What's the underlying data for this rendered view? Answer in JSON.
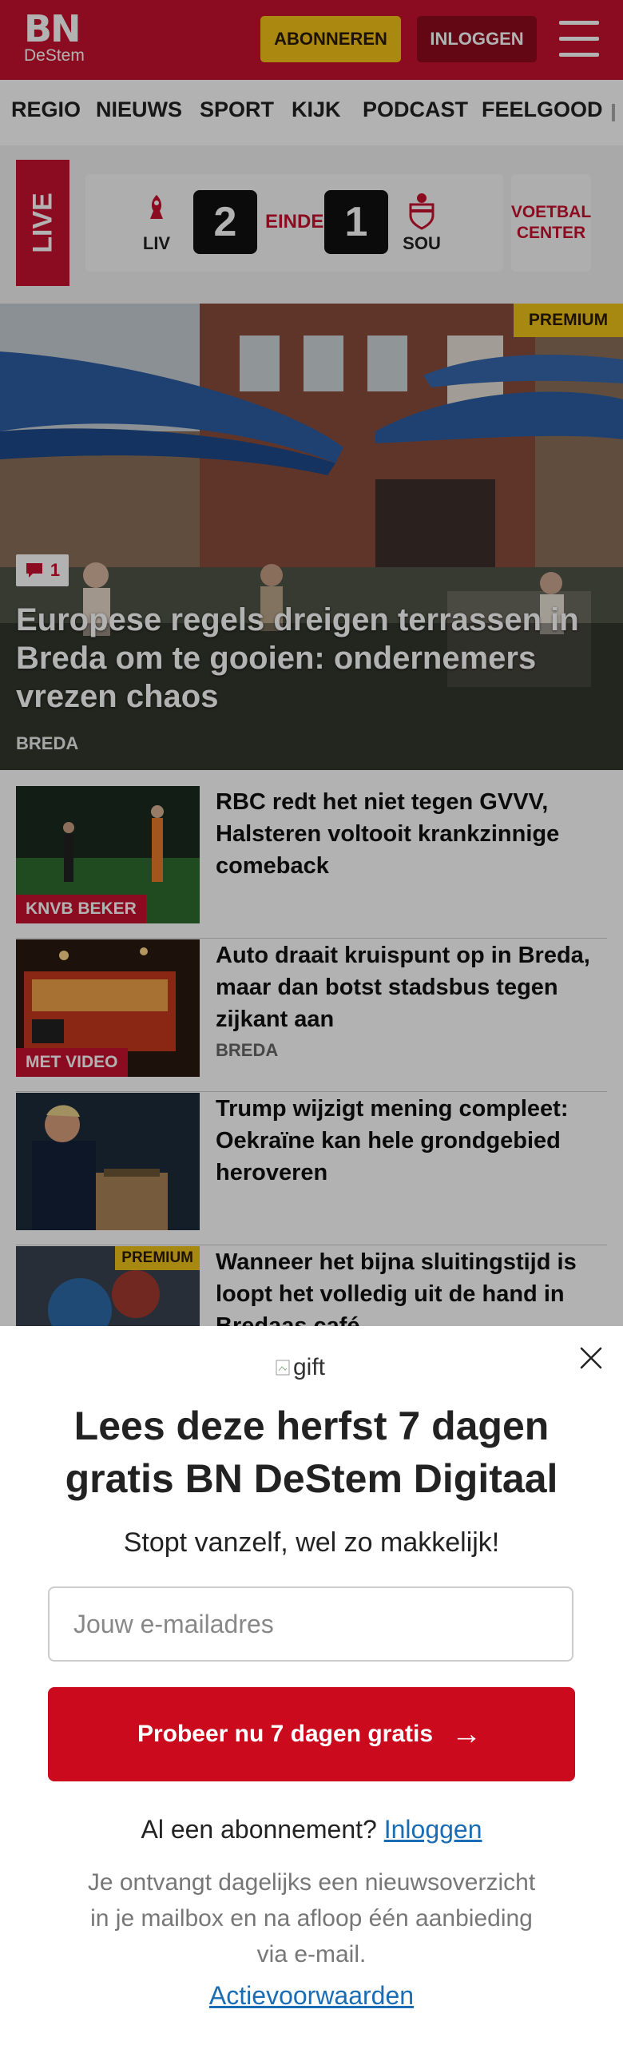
{
  "header": {
    "logo_main": "BN",
    "logo_sub": "DeStem",
    "subscribe_label": "ABONNEREN",
    "login_label": "INLOGGEN",
    "brand_color": "#c8102e"
  },
  "nav": {
    "items": [
      "REGIO",
      "NIEUWS",
      "SPORT",
      "KIJK",
      "PODCAST",
      "FEELGOOD"
    ]
  },
  "live": {
    "badge": "LIVE",
    "home_team": "LIV",
    "away_team": "SOU",
    "home_score": "2",
    "away_score": "1",
    "status": "EINDE",
    "center_label_1": "VOETBAL",
    "center_label_2": "CENTER"
  },
  "hero": {
    "premium": "PREMIUM",
    "comments": "1",
    "title": "Europese regels dreigen terrassen in Breda om te gooien: ondernemers vrezen chaos",
    "location": "BREDA"
  },
  "articles": [
    {
      "title": "RBC redt het niet tegen GVVV, Halsteren voltooit krankzinnige comeback",
      "label": "KNVB BEKER"
    },
    {
      "title": "Auto draait kruispunt op in Breda, maar dan botst stadsbus tegen zijkant aan",
      "label": "MET VIDEO",
      "location": "BREDA"
    },
    {
      "title": "Trump wijzigt mening compleet: Oekraïne kan hele grondgebied heroveren"
    },
    {
      "title": "Wanneer het bijna sluitingstijd is loopt het volledig uit de hand in Bredaas café",
      "premium": "PREMIUM"
    }
  ],
  "modal": {
    "gift_alt": "gift",
    "title": "Lees deze herfst 7 dagen gratis BN DeStem Digitaal",
    "subtitle": "Stopt vanzelf, wel zo makkelijk!",
    "email_placeholder": "Jouw e-mailadres",
    "cta_label": "Probeer nu 7 dagen gratis",
    "login_prompt": "Al een abonnement?",
    "login_link": "Inloggen",
    "info": "Je ontvangt dagelijks een nieuwsoverzicht in je mailbox en na afloop één aanbieding via e-mail.",
    "terms": "Actievoorwaarden"
  }
}
